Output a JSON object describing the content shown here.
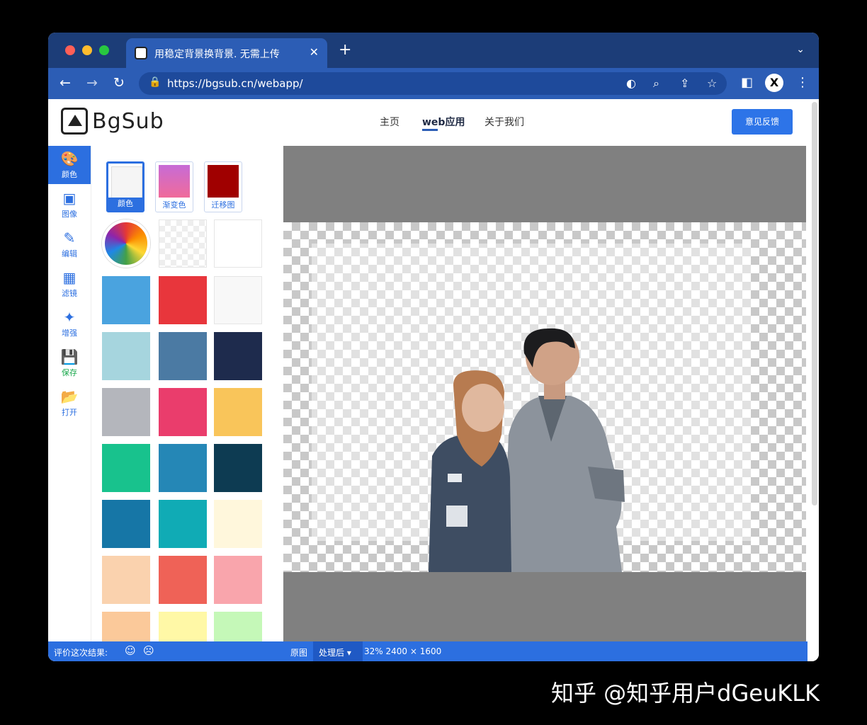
{
  "browser": {
    "tab_title": "用稳定背景换背景. 无需上传",
    "url": "https://bgsub.cn/webapp/",
    "traffic_lights": {
      "red": "#ff5f57",
      "yellow": "#febc2e",
      "green": "#28c840"
    }
  },
  "header": {
    "logo_text": "BgSub",
    "nav": [
      "主页",
      "web应用",
      "关于我们"
    ],
    "active_nav_index": 1,
    "feedback_button": "意见反馈"
  },
  "sidebar": {
    "items": [
      {
        "label": "颜色",
        "icon": "palette-icon"
      },
      {
        "label": "图像",
        "icon": "image-icon"
      },
      {
        "label": "编辑",
        "icon": "pencil-icon"
      },
      {
        "label": "滤镜",
        "icon": "grid-icon"
      },
      {
        "label": "增强",
        "icon": "sparkle-icon"
      },
      {
        "label": "保存",
        "icon": "save-icon"
      },
      {
        "label": "打开",
        "icon": "folder-open-icon"
      }
    ],
    "active_index": 0
  },
  "palette": {
    "modes": [
      {
        "label": "颜色",
        "color": "#f5f5f5"
      },
      {
        "label": "渐变色",
        "color": "linear-gradient(#c76bd6,#f06b9a)"
      },
      {
        "label": "迁移图",
        "color": "#a00000"
      }
    ],
    "colors": [
      "#4aa3df",
      "#e8363c",
      "#f8f8f8",
      "#a6d5de",
      "#4b7aa3",
      "#1e2b4d",
      "#b4b6bc",
      "#ea3d6c",
      "#f9c55a",
      "#18c28d",
      "#2587b6",
      "#0d3b52",
      "#1676a6",
      "#10abb5",
      "#fff7dc",
      "#fad2ae",
      "#ef6257",
      "#f9a5ac",
      "#fbc99a",
      "#fff8a6",
      "#c5f8b8"
    ]
  },
  "statusbar": {
    "rate_text": "评价这次结果:",
    "original_label": "原图",
    "processed_label": "处理后 ▾",
    "zoom_info": "32% 2400 × 1600"
  },
  "watermark": "知乎 @知乎用户dGeuKLK"
}
